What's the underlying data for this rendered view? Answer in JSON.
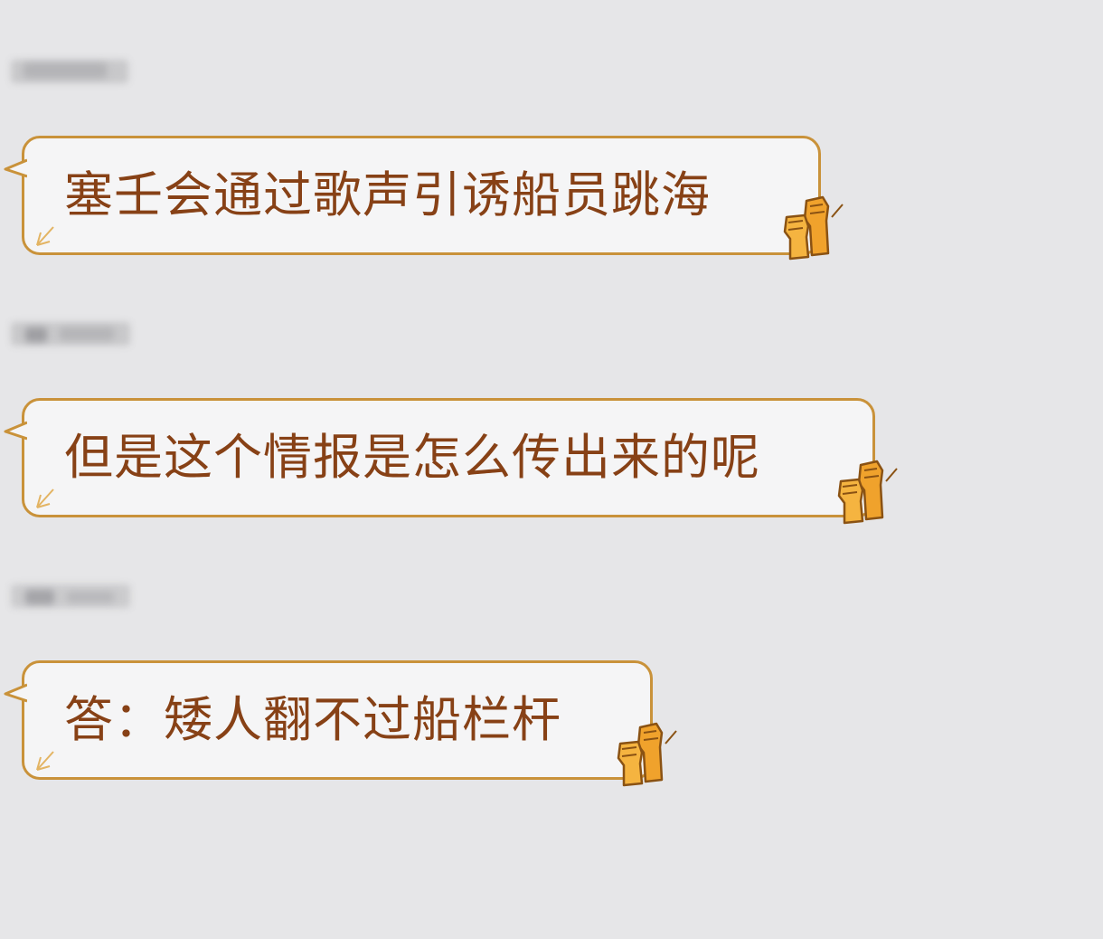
{
  "colors": {
    "background": "#e6e6e8",
    "bubble_fill": "#f5f5f6",
    "bubble_border": "#c9923a",
    "message_text": "#874116",
    "fist_fill": "#f0a22c"
  },
  "messages": [
    {
      "text": "塞壬会通过歌声引诱船员跳海",
      "sender_name_blurred": true,
      "sticker_icon": "raised-fists-icon"
    },
    {
      "text": "但是这个情报是怎么传出来的呢",
      "sender_name_blurred": true,
      "sticker_icon": "raised-fists-icon"
    },
    {
      "text": "答：矮人翻不过船栏杆",
      "sender_name_blurred": true,
      "sticker_icon": "raised-fists-icon"
    }
  ]
}
